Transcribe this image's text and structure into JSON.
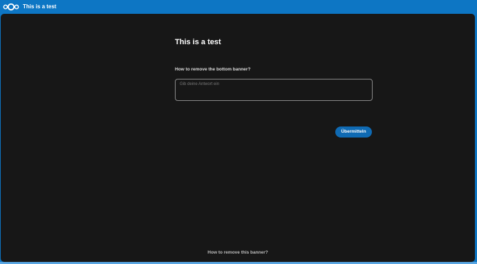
{
  "header": {
    "title": "This is a test",
    "logo_icon": "nextcloud-logo-icon",
    "background_color": "#0d76c4"
  },
  "form": {
    "title": "This is a test",
    "question": {
      "label": "How to remove the bottom banner?",
      "placeholder": "Gib deine Antwort ein",
      "value": ""
    },
    "submit_label": "Übermitteln",
    "accent_color": "#0f6ab3"
  },
  "footer": {
    "banner_link": "How to remove this banner?"
  }
}
